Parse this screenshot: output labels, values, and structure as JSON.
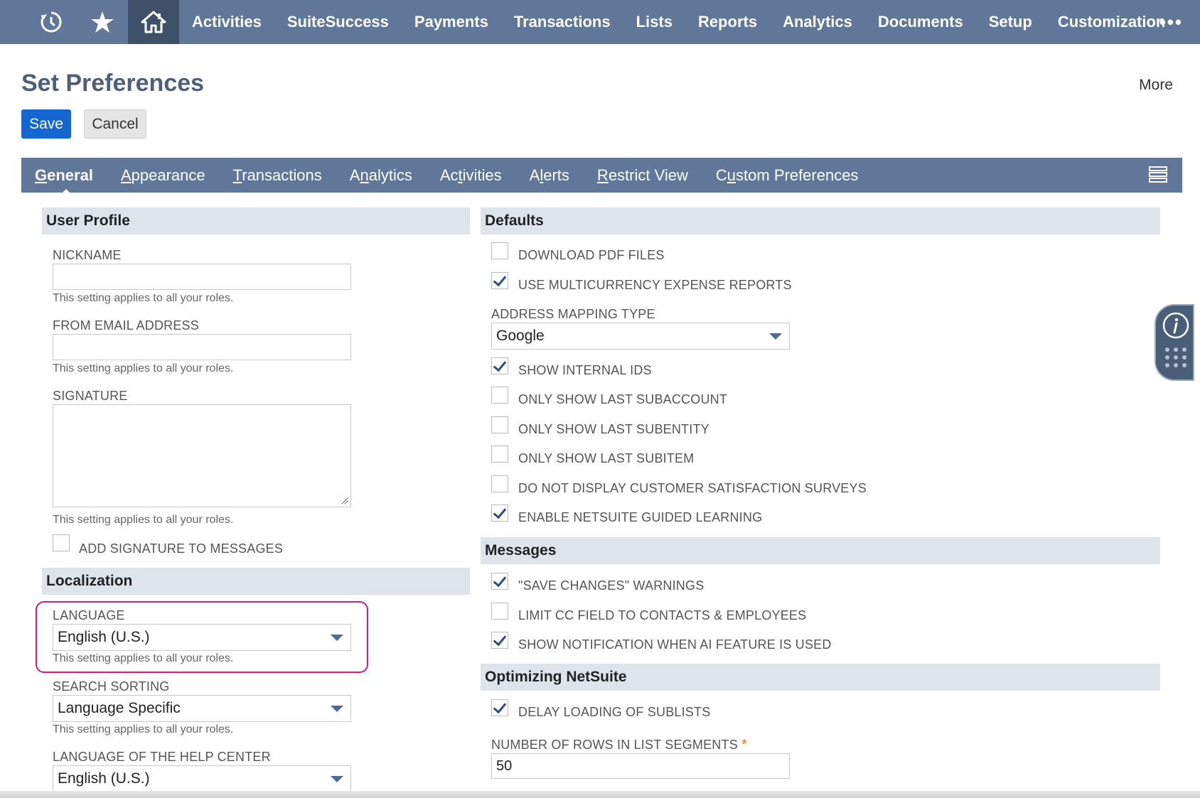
{
  "topnav": {
    "items": [
      "Activities",
      "SuiteSuccess",
      "Payments",
      "Transactions",
      "Lists",
      "Reports",
      "Analytics",
      "Documents",
      "Setup",
      "Customization"
    ],
    "more": "•••"
  },
  "page": {
    "title": "Set Preferences",
    "more": "More"
  },
  "buttons": {
    "save": "Save",
    "cancel": "Cancel"
  },
  "subtabs": [
    {
      "pre": "",
      "ul": "G",
      "post": "eneral"
    },
    {
      "pre": "",
      "ul": "A",
      "post": "ppearance"
    },
    {
      "pre": "",
      "ul": "T",
      "post": "ransactions"
    },
    {
      "pre": "A",
      "ul": "n",
      "post": "alytics"
    },
    {
      "pre": "Ac",
      "ul": "t",
      "post": "ivities"
    },
    {
      "pre": "A",
      "ul": "l",
      "post": "erts"
    },
    {
      "pre": "",
      "ul": "R",
      "post": "estrict View"
    },
    {
      "pre": "C",
      "ul": "u",
      "post": "stom Preferences"
    }
  ],
  "user_profile": {
    "header": "User Profile",
    "nickname_label": "NICKNAME",
    "nickname_value": "",
    "from_email_label": "FROM EMAIL ADDRESS",
    "from_email_value": "",
    "signature_label": "SIGNATURE",
    "help": "This setting applies to all your roles.",
    "add_signature_label": "ADD SIGNATURE TO MESSAGES",
    "add_signature_checked": false
  },
  "localization": {
    "header": "Localization",
    "language_label": "LANGUAGE",
    "language_value": "English (U.S.)",
    "search_sorting_label": "SEARCH SORTING",
    "search_sorting_value": "Language Specific",
    "help_center_label": "LANGUAGE OF THE HELP CENTER",
    "help_center_value": "English (U.S.)",
    "help": "This setting applies to all your roles."
  },
  "defaults": {
    "header": "Defaults",
    "download_pdf": "DOWNLOAD PDF FILES",
    "multicurrency": "USE MULTICURRENCY EXPENSE REPORTS",
    "address_mapping_label": "ADDRESS MAPPING TYPE",
    "address_mapping_value": "Google",
    "internal_ids": "SHOW INTERNAL IDS",
    "last_subaccount": "ONLY SHOW LAST SUBACCOUNT",
    "last_subentity": "ONLY SHOW LAST SUBENTITY",
    "last_subitem": "ONLY SHOW LAST SUBITEM",
    "no_surveys": "DO NOT DISPLAY CUSTOMER SATISFACTION SURVEYS",
    "guided_learning": "ENABLE NETSUITE GUIDED LEARNING"
  },
  "messages": {
    "header": "Messages",
    "save_changes": "\"SAVE CHANGES\" WARNINGS",
    "limit_cc": "LIMIT CC FIELD TO CONTACTS & EMPLOYEES",
    "ai_notification": "SHOW NOTIFICATION WHEN AI FEATURE IS USED"
  },
  "optimizing": {
    "header": "Optimizing NetSuite",
    "delay_sublists": "DELAY LOADING OF SUBLISTS",
    "rows_label": "NUMBER OF ROWS IN LIST SEGMENTS",
    "rows_required": "*",
    "rows_value": "50"
  },
  "colors": {
    "nav": "#607799",
    "save": "#1467d1",
    "highlight": "#d6197a"
  }
}
